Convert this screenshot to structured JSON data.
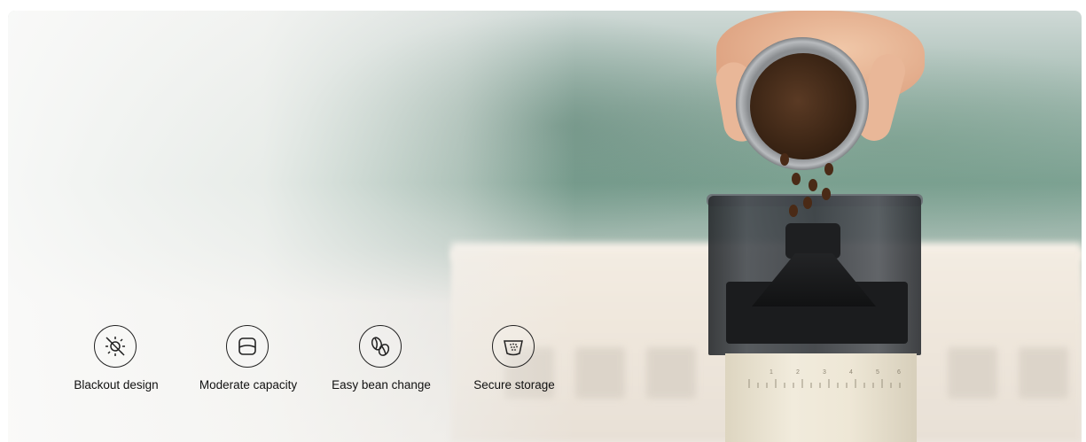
{
  "features": [
    {
      "label": "Blackout design",
      "icon": "blackout-sun-icon"
    },
    {
      "label": "Moderate capacity",
      "icon": "capacity-container-icon"
    },
    {
      "label": "Easy bean change",
      "icon": "coffee-beans-icon"
    },
    {
      "label": "Secure storage",
      "icon": "storage-bowl-icon"
    }
  ],
  "scale": {
    "ticks": [
      "1",
      "2",
      "3",
      "4",
      "5",
      "6"
    ]
  }
}
